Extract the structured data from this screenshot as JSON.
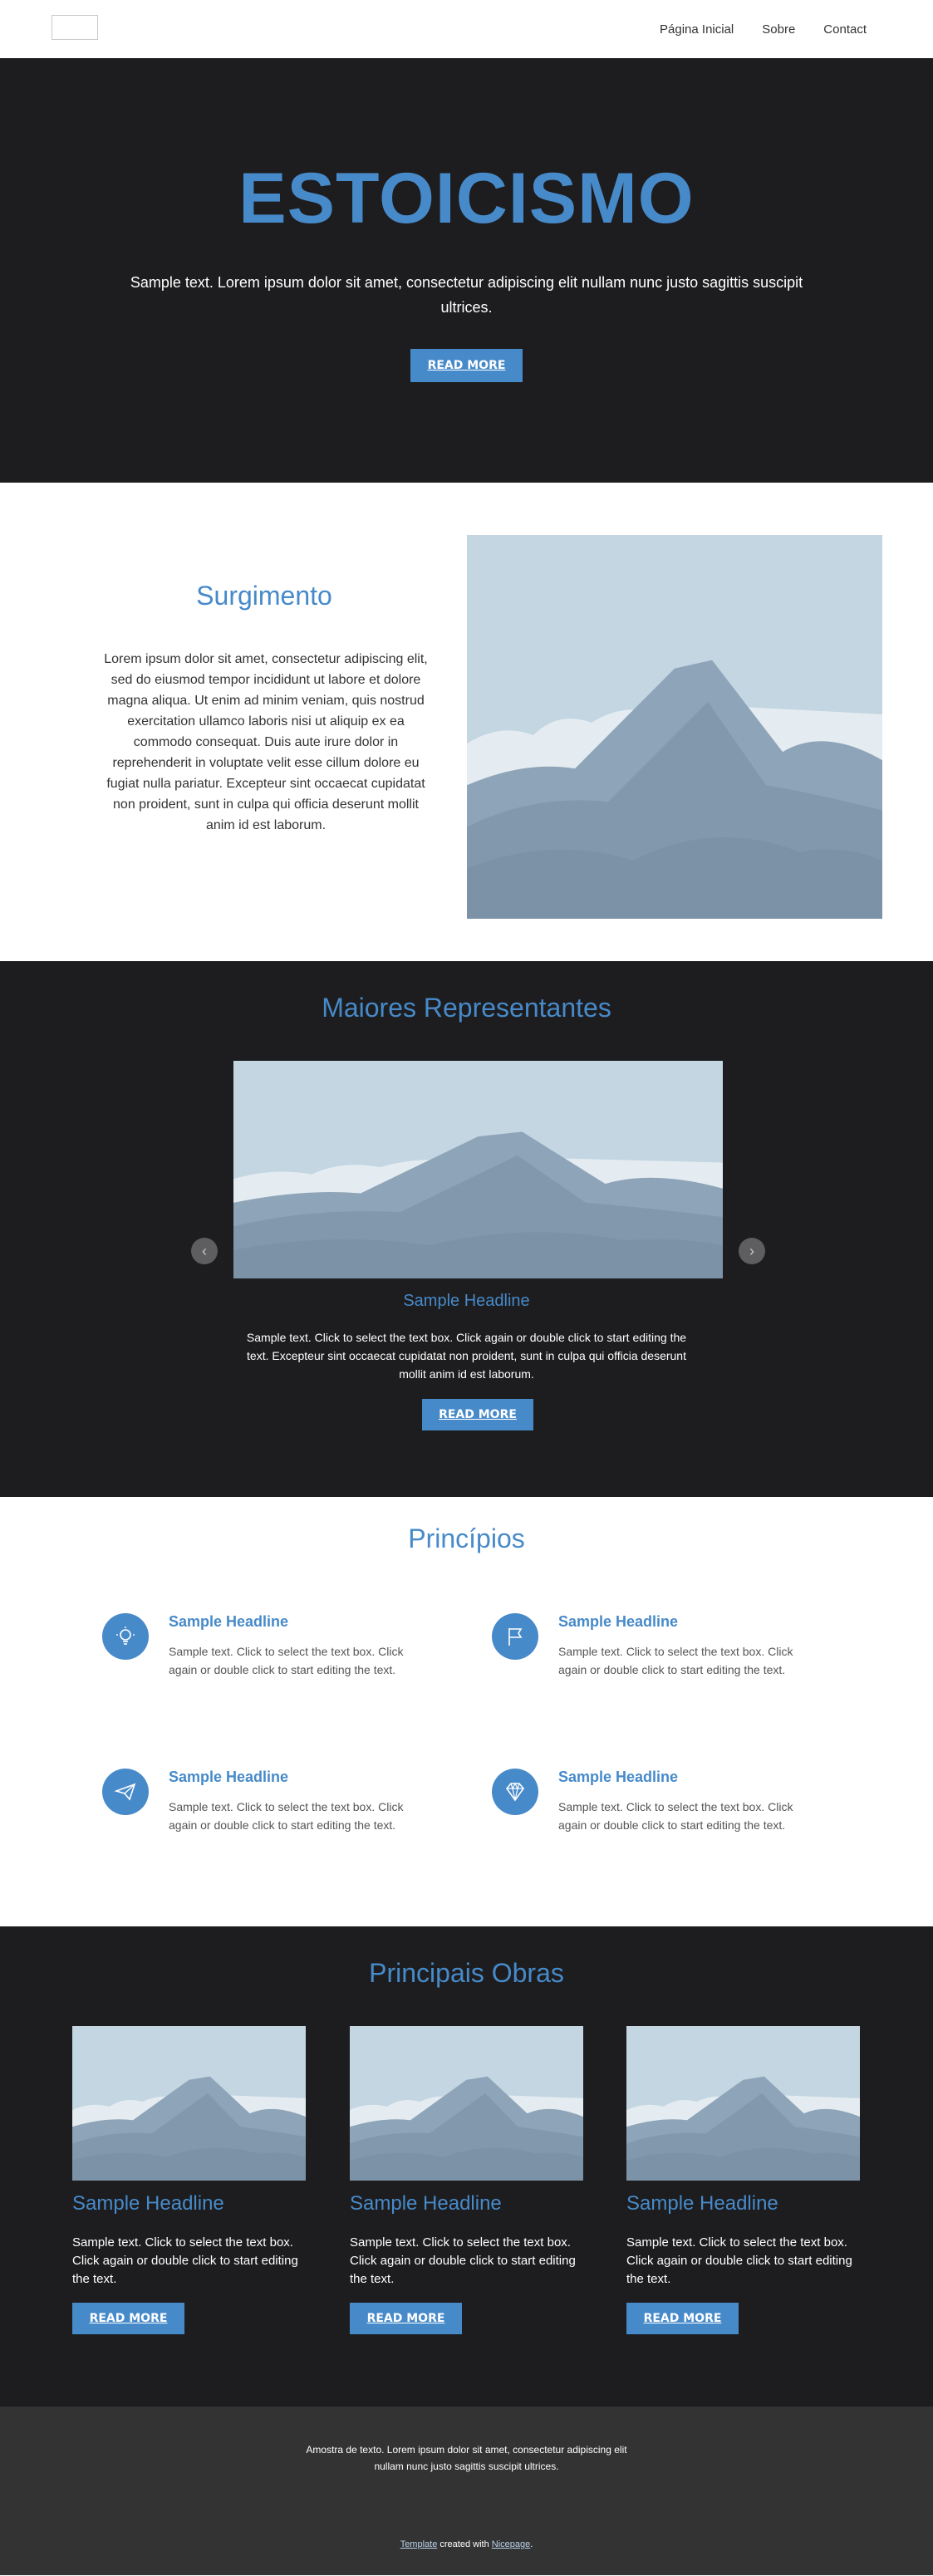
{
  "header": {
    "nav": [
      "Página Inicial",
      "Sobre",
      "Contact"
    ]
  },
  "hero": {
    "title": "ESTOICISMO",
    "text": "Sample text. Lorem ipsum dolor sit amet, consectetur adipiscing elit nullam nunc justo sagittis suscipit ultrices.",
    "button": "READ MORE"
  },
  "surgimento": {
    "title": "Surgimento",
    "text": "Lorem ipsum dolor sit amet, consectetur adipiscing elit, sed do eiusmod tempor incididunt ut labore et dolore magna aliqua. Ut enim ad minim veniam, quis nostrud exercitation ullamco laboris nisi ut aliquip ex ea commodo consequat. Duis aute irure dolor in reprehenderit in voluptate velit esse cillum dolore eu fugiat nulla pariatur. Excepteur sint occaecat cupidatat non proident, sunt in culpa qui officia deserunt mollit anim id est laborum."
  },
  "representantes": {
    "title": "Maiores Representantes",
    "headline": "Sample Headline",
    "text": "Sample text. Click to select the text box. Click again or double click to start editing the text. Excepteur sint occaecat cupidatat non proident, sunt in culpa qui officia deserunt mollit anim id est laborum.",
    "button": "READ MORE"
  },
  "principios": {
    "title": "Princípios",
    "items": [
      {
        "headline": "Sample Headline",
        "text": "Sample text. Click to select the text box. Click again or double click to start editing the text.",
        "icon": "lightbulb-icon"
      },
      {
        "headline": "Sample Headline",
        "text": "Sample text. Click to select the text box. Click again or double click to start editing the text.",
        "icon": "flag-icon"
      },
      {
        "headline": "Sample Headline",
        "text": "Sample text. Click to select the text box. Click again or double click to start editing the text.",
        "icon": "paper-plane-icon"
      },
      {
        "headline": "Sample Headline",
        "text": "Sample text. Click to select the text box. Click again or double click to start editing the text.",
        "icon": "diamond-icon"
      }
    ]
  },
  "obras": {
    "title": "Principais Obras",
    "cards": [
      {
        "headline": "Sample Headline",
        "text": "Sample text. Click to select the text box. Click again or double click to start editing the text.",
        "button": "READ MORE"
      },
      {
        "headline": "Sample Headline",
        "text": "Sample text. Click to select the text box. Click again or double click to start editing the text.",
        "button": "READ MORE"
      },
      {
        "headline": "Sample Headline",
        "text": "Sample text. Click to select the text box. Click again or double click to start editing the text.",
        "button": "READ MORE"
      }
    ]
  },
  "footer": {
    "text": "Amostra de texto. Lorem ipsum dolor sit amet, consectetur adipiscing elit nullam nunc justo sagittis suscipit ultrices.",
    "template_link": "Template",
    "created_with": "created with",
    "builder_link": "Nicepage",
    "period": "."
  },
  "colors": {
    "accent": "#478ac9",
    "dark_bg": "#1d1d1f",
    "footer_bg": "#333333"
  }
}
